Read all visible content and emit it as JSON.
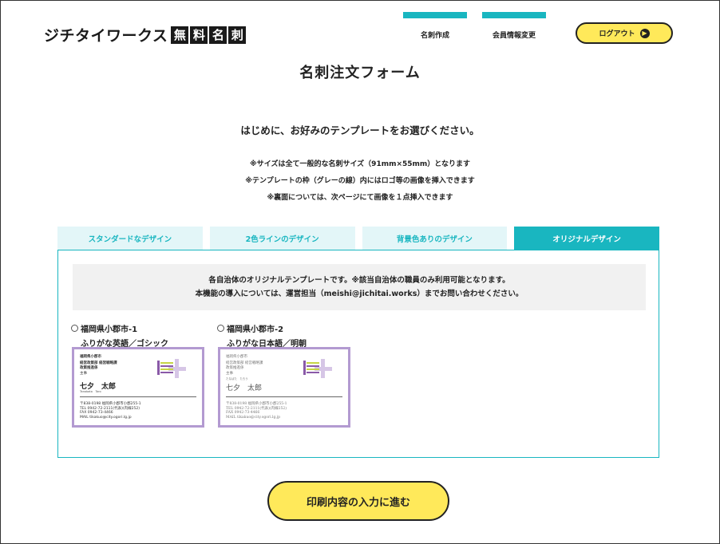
{
  "header": {
    "logo_text": "ジチタイワークス",
    "logo_boxes": [
      "無",
      "料",
      "名",
      "刺"
    ],
    "nav": [
      {
        "label": "名刺作成"
      },
      {
        "label": "会員情報変更"
      }
    ],
    "logout_label": "ログアウト",
    "logout_icon": "arrow-right-circle-icon"
  },
  "page_title": "名刺注文フォーム",
  "intro": "はじめに、お好みのテンプレートをお選びください。",
  "notes": [
    "※サイズは全て一般的な名刺サイズ（91mm×55mm）となります",
    "※テンプレートの枠（グレーの線）内にはロゴ等の画像を挿入できます",
    "※裏面については、次ページにて画像を１点挿入できます"
  ],
  "tabs": [
    {
      "label": "スタンダードなデザイン",
      "active": false
    },
    {
      "label": "2色ラインのデザイン",
      "active": false
    },
    {
      "label": "背景色ありのデザイン",
      "active": false
    },
    {
      "label": "オリジナルデザイン",
      "active": true
    }
  ],
  "notice": {
    "line1": "各自治体のオリジナルテンプレートです。※該当自治体の職員のみ利用可能となります。",
    "line2": "本機能の導入については、運営担当（meishi@jichitai.works）までお問い合わせください。"
  },
  "options": [
    {
      "name": "福岡県小郡市-1",
      "subtitle": "ふりがな英語／ゴシック",
      "card": {
        "org": "福岡県小郡市",
        "dept1": "経営政策部 経営戦略課",
        "dept2": "政策推進係",
        "title": "主事",
        "name": "七夕　太郎",
        "reading": "Tanabata　Taro",
        "address": "〒838-0198 福岡県小郡市小郡255-1",
        "tel": "TEL 0942-72-2111(代表)(内線252)",
        "fax": "FAX 0942-73-4466",
        "mail": "MAIL tikakuo@city.ogori.lg.jp"
      }
    },
    {
      "name": "福岡県小郡市-2",
      "subtitle": "ふりがな日本語／明朝",
      "card": {
        "org": "福岡県小郡市",
        "dept1": "経営政策部 経営戦略課",
        "dept2": "政策推進係",
        "title": "主事",
        "name": "七夕　太郎",
        "reading": "たなばた　たろう",
        "address": "〒838-0198 福岡県小郡市小郡255-1",
        "tel": "TEL 0942-72-2111(代表)(内線252)",
        "fax": "FAX 0942-73-4466",
        "mail": "MAIL tikakuo@city.ogori.lg.jp"
      }
    }
  ],
  "proceed_label": "印刷内容の入力に進む",
  "colors": {
    "accent": "#19b6c0",
    "button": "#ffe95a",
    "tab_inactive": "#e3f6f8",
    "card_border": "#b39ad1",
    "emblem_purple": "#8a5aa8",
    "emblem_green": "#c6d545",
    "emblem_cross": "#d6c6e6"
  }
}
